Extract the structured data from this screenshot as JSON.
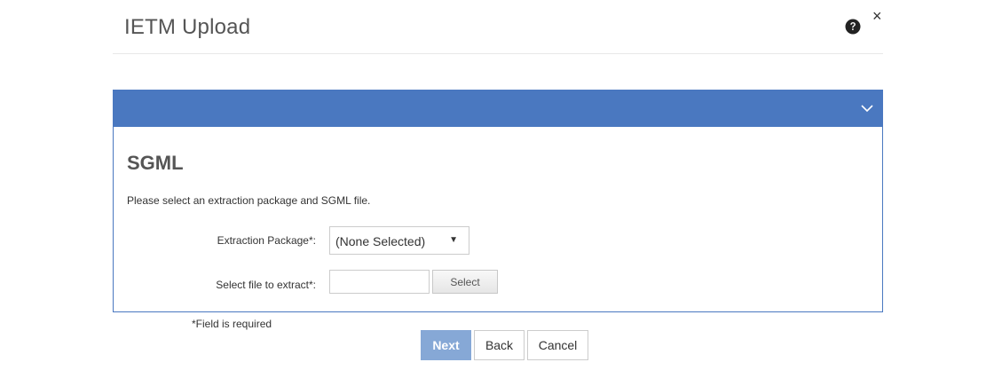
{
  "dialog": {
    "title": "IETM Upload",
    "help_icon": "question-circle-icon",
    "close_icon": "close-icon",
    "close_glyph": "×"
  },
  "panel": {
    "collapse_icon": "chevron-down-icon",
    "section_title": "SGML",
    "instructions": "Please select an extraction package and SGML file.",
    "accent_color": "#4a78c0"
  },
  "form": {
    "extraction_package": {
      "label": "Extraction Package*:",
      "selected_value": "(None Selected)"
    },
    "file": {
      "label": "Select file to extract*:",
      "value": "",
      "button_label": "Select"
    }
  },
  "footer": {
    "required_note": "*Field is required",
    "next_label": "Next",
    "back_label": "Back",
    "cancel_label": "Cancel",
    "next_color": "#86a8d6"
  }
}
